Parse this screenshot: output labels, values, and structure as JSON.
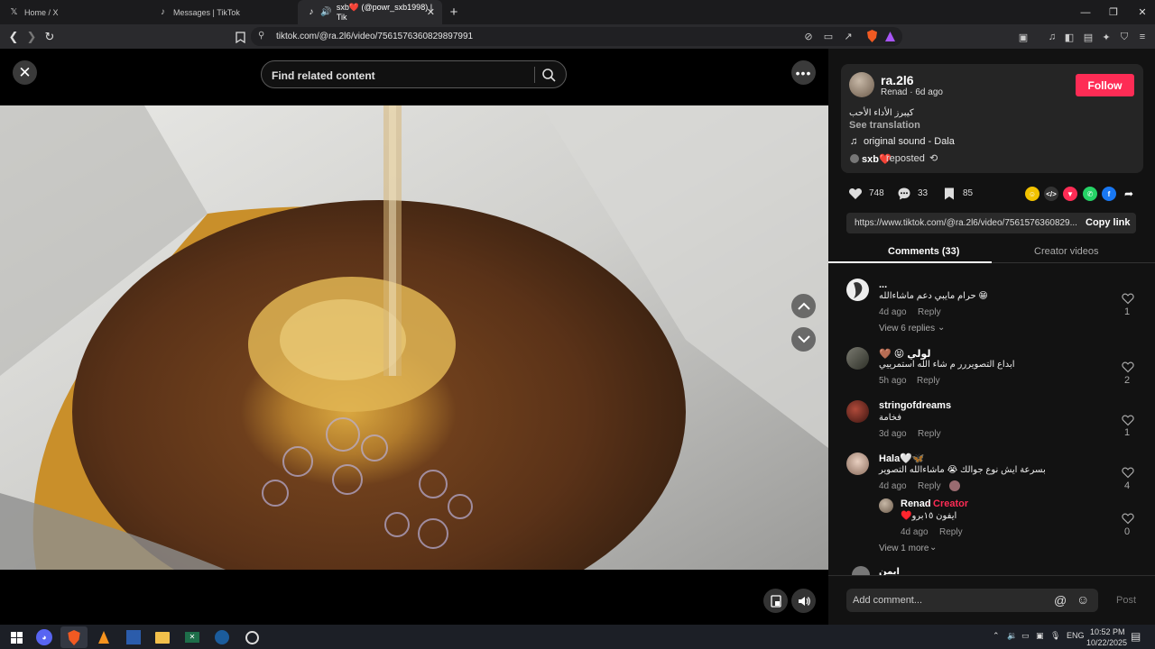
{
  "browser": {
    "tabs": [
      {
        "label": "Home / X",
        "icon": "x-logo-icon"
      },
      {
        "label": "Messages | TikTok",
        "icon": "tiktok-icon"
      },
      {
        "label": "sxb❤️ (@powr_sxb1998) | Tik",
        "icon": "tiktok-icon",
        "active": true
      }
    ],
    "url": "tiktok.com/@ra.2l6/video/7561576360829897991"
  },
  "viewer": {
    "search_placeholder": "Find related content"
  },
  "author": {
    "username": "ra.2l6",
    "meta": "Renad · 6d ago",
    "follow_label": "Follow",
    "caption": "كيبرز الأداء الأحب",
    "see_translation": "See translation",
    "sound": "original sound - Dala",
    "reposted_by": "sxb❤️",
    "reposted_label": "reposted"
  },
  "stats": {
    "likes": "748",
    "comments": "33",
    "saves": "85"
  },
  "share": {
    "link": "https://www.tiktok.com/@ra.2l6/video/7561576360829...",
    "copy_label": "Copy link"
  },
  "tabs": {
    "comments": "Comments (33)",
    "creator": "Creator videos"
  },
  "comments": [
    {
      "name": "...",
      "text": "حرام مايبي دعم ماشاءالله 😁",
      "time": "4d ago",
      "reply": "Reply",
      "likes": "1",
      "view_replies": "View 6 replies"
    },
    {
      "name": "لولي 😝 🤎",
      "text": "ابداع التصويررر م شاء الله استمرييي",
      "time": "5h ago",
      "reply": "Reply",
      "likes": "2"
    },
    {
      "name": "stringofdreams",
      "text": "فخامة",
      "time": "3d ago",
      "reply": "Reply",
      "likes": "1"
    },
    {
      "name": "Hala🤍🦋",
      "text": "بسرعة ايش نوع جوالك 😭 ماشاءالله التصوير",
      "time": "4d ago",
      "reply": "Reply",
      "likes": "4"
    }
  ],
  "reply": {
    "name": "Renad",
    "badge": "Creator",
    "text": "ايفون ١٥برو♥️",
    "time": "4d ago",
    "reply": "Reply",
    "likes": "0",
    "view_more": "View 1 more"
  },
  "partial_comment": {
    "name": "ايمن"
  },
  "composer": {
    "placeholder": "Add comment...",
    "post_label": "Post"
  },
  "taskbar": {
    "language": "ENG",
    "time": "10:52 PM",
    "date": "10/22/2025"
  },
  "colors": {
    "accent": "#fe2c55",
    "panel_bg": "#121212",
    "card_bg": "#252525"
  }
}
